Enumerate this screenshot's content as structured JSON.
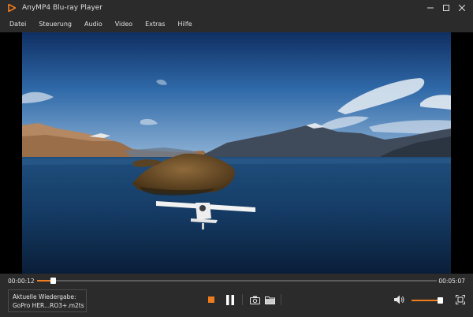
{
  "window": {
    "title": "AnyMP4 Blu-ray Player",
    "logo_icon": "play-triangle-logo",
    "controls": [
      "minimize-icon",
      "maximize-icon",
      "close-icon"
    ]
  },
  "menu": {
    "items": [
      {
        "label": "Datei"
      },
      {
        "label": "Steuerung"
      },
      {
        "label": "Audio"
      },
      {
        "label": "Video"
      },
      {
        "label": "Extras"
      },
      {
        "label": "Hilfe"
      }
    ]
  },
  "player": {
    "current_time": "00:00:12",
    "total_time": "00:05:07",
    "progress_fraction": 0.039,
    "volume_fraction": 0.9,
    "accent_color": "#f07d1d",
    "now_playing_label": "Aktuelle Wiedergabe:",
    "now_playing_file": "GoPro HER...RO3+.m2ts",
    "icons": {
      "stop": "stop-icon",
      "pause": "pause-icon",
      "snapshot": "camera-icon",
      "open_folder": "folder-icon",
      "volume": "speaker-icon",
      "fullscreen": "fullscreen-icon"
    }
  }
}
